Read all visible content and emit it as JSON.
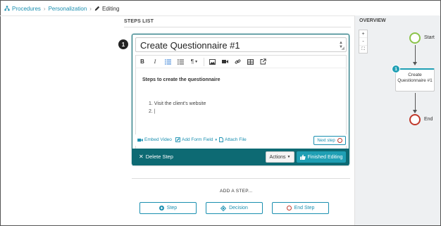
{
  "breadcrumb": {
    "items": [
      "Procedures",
      "Personalization"
    ],
    "current": "Editing"
  },
  "steps": {
    "label": "STEPS LIST",
    "step_number": "1",
    "title": "Create Questionnaire #1",
    "content_heading": "Steps to create the questionnaire",
    "list_items": [
      "Visit the client's website",
      ""
    ],
    "list_numbers": [
      "1.",
      "2."
    ],
    "embed_video": "Embed Video",
    "add_form_field": "Add Form Field",
    "attach_file": "Attach File",
    "next_step": "Next step",
    "delete_step": "Delete Step",
    "actions": "Actions",
    "finished_editing": "Finished Editing"
  },
  "toolbar": {
    "bold": "B",
    "italic": "I",
    "paragraph": "¶"
  },
  "add_step": {
    "label": "ADD A STEP...",
    "step": "Step",
    "decision": "Decision",
    "end_step": "End Step"
  },
  "overview": {
    "title": "OVERVIEW",
    "zoom_in": "+",
    "zoom_out": "-",
    "start": "Start",
    "end": "End",
    "step_number": "1",
    "step_label": "Create Questionnaire #1"
  },
  "colors": {
    "primary": "#0d6a73",
    "accent": "#1f9fb4",
    "link": "#1a8fb0",
    "start": "#8bc34a",
    "end": "#c0392b"
  }
}
